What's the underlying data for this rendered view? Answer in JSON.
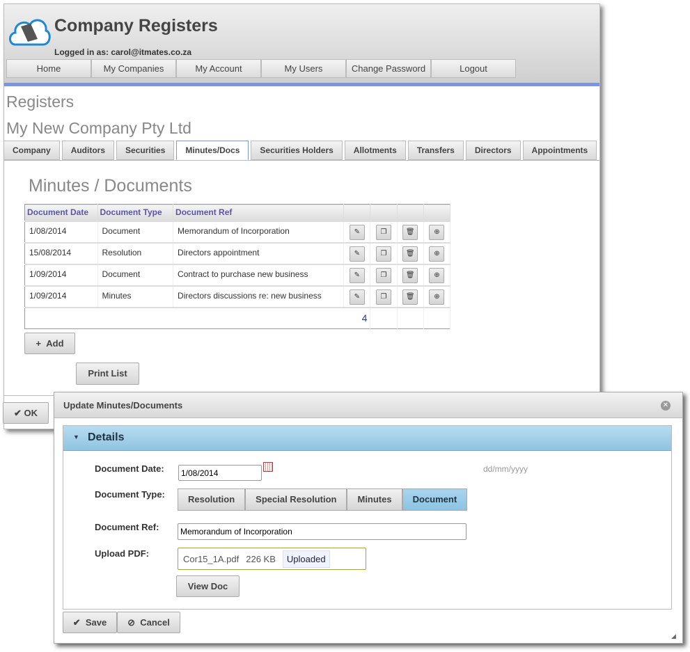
{
  "app": {
    "title": "Company Registers",
    "logged_in": "Logged in as: carol@itmates.co.za"
  },
  "nav": [
    "Home",
    "My Companies",
    "My Account",
    "My Users",
    "Change Password",
    "Logout"
  ],
  "page": {
    "heading": "Registers",
    "company": "My New Company Pty Ltd"
  },
  "tabs": [
    {
      "label": "Company"
    },
    {
      "label": "Auditors"
    },
    {
      "label": "Securities"
    },
    {
      "label": "Minutes/Docs",
      "active": true
    },
    {
      "label": "Securities Holders"
    },
    {
      "label": "Allotments"
    },
    {
      "label": "Transfers"
    },
    {
      "label": "Directors"
    },
    {
      "label": "Appointments"
    }
  ],
  "section": {
    "title": "Minutes / Documents"
  },
  "table": {
    "headers": [
      "Document Date",
      "Document Type",
      "Document Ref"
    ],
    "rows": [
      [
        "1/08/2014",
        "Document",
        "Memorandum of Incorporation"
      ],
      [
        "15/08/2014",
        "Resolution",
        "Directors appointment"
      ],
      [
        "1/09/2014",
        "Document",
        "Contract to purchase new business"
      ],
      [
        "1/09/2014",
        "Minutes",
        "Directors discussions re: new business"
      ]
    ],
    "row_actions": [
      "edit-icon",
      "copy-icon",
      "trash-icon",
      "zoom-icon"
    ],
    "count": "4"
  },
  "buttons": {
    "add": "Add",
    "print": "Print List",
    "ok": "OK"
  },
  "dialog": {
    "title": "Update Minutes/Documents",
    "section": "Details",
    "date_label": "Document Date:",
    "date_value": "1/08/2014",
    "date_hint": "dd/mm/yyyy",
    "type_label": "Document Type:",
    "types": [
      "Resolution",
      "Special Resolution",
      "Minutes",
      "Document"
    ],
    "type_selected": "Document",
    "ref_label": "Document Ref:",
    "ref_value": "Memorandum of Incorporation",
    "upload_label": "Upload PDF:",
    "file_name": "Cor15_1A.pdf",
    "file_size": "226 KB",
    "upload_status": "Uploaded",
    "view_doc": "View Doc",
    "save": "Save",
    "cancel": "Cancel"
  },
  "colors": {
    "accent": "#7b96dc",
    "header_text": "#5a55a8",
    "details": "#9fcde8"
  }
}
